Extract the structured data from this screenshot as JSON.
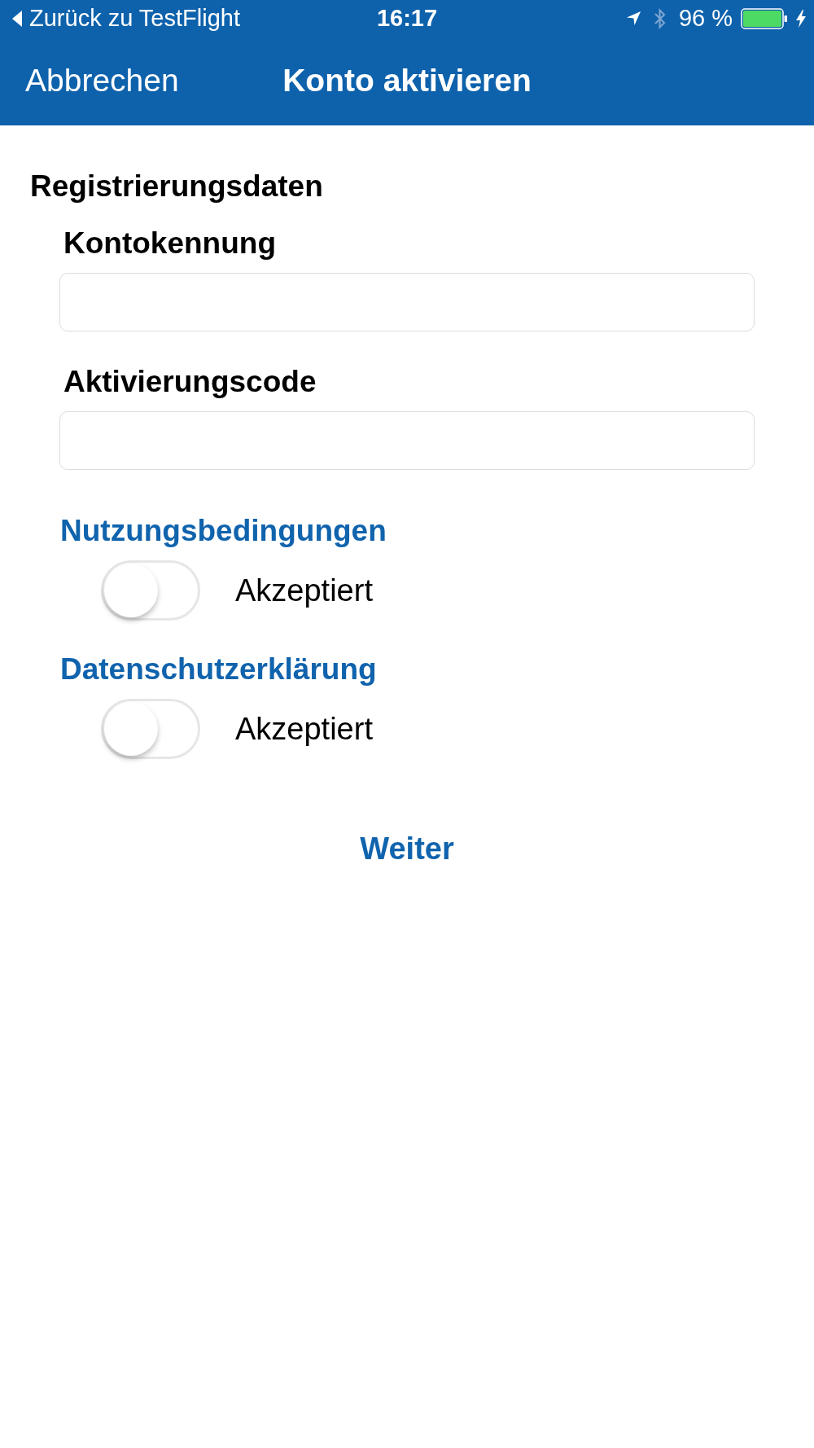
{
  "status_bar": {
    "back_link": "Zurück zu TestFlight",
    "time": "16:17",
    "battery_percent": "96 %"
  },
  "nav_bar": {
    "cancel": "Abbrechen",
    "title": "Konto aktivieren"
  },
  "section_title": "Registrierungsdaten",
  "fields": [
    {
      "label": "Kontokennung"
    },
    {
      "label": "Aktivierungscode"
    }
  ],
  "consents": [
    {
      "link": "Nutzungsbedingungen",
      "toggle_label": "Akzeptiert",
      "on": false
    },
    {
      "link": "Datenschutzerklärung",
      "toggle_label": "Akzeptiert",
      "on": false
    }
  ],
  "continue_button": "Weiter"
}
